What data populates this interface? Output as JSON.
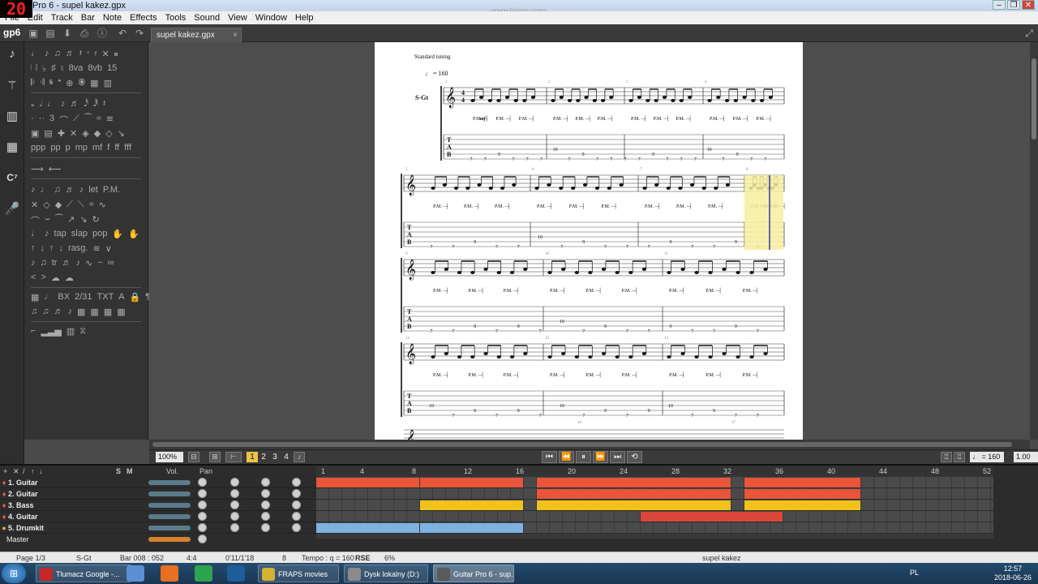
{
  "window": {
    "fps_counter": "20",
    "title": "Pro 6 - supel kakez.gpx",
    "watermark": "www.fraps.com",
    "controls": [
      "–",
      "❐",
      "✕"
    ]
  },
  "menu": [
    "File",
    "Edit",
    "Track",
    "Bar",
    "Note",
    "Effects",
    "Tools",
    "Sound",
    "View",
    "Window",
    "Help"
  ],
  "toolbar": {
    "logo": "gp6",
    "document_tab": "supel kakez.gpx",
    "tab_close": "×"
  },
  "score": {
    "tuning": "Standard tuning",
    "tempo_mark": "♩ = 160",
    "track_label": "S-Gt",
    "dynamic": "mf",
    "palm_mute": "P.M.",
    "tab_letters": [
      "T",
      "A",
      "B"
    ],
    "measure_numbers": [
      "1",
      "2",
      "3",
      "4",
      "5",
      "6",
      "7",
      "8",
      "9",
      "10",
      "11",
      "12",
      "13",
      "14",
      "15",
      "16",
      "17"
    ],
    "tab_numbers_row1": [
      "7",
      "7",
      "9",
      "7",
      "7",
      "7",
      "10",
      "7",
      "9",
      "7",
      "7",
      "7",
      "7",
      "9",
      "7",
      "7",
      "7",
      "10",
      "7",
      "9",
      "7",
      "7"
    ],
    "tab_numbers_row2": [
      "7",
      "7",
      "9",
      "7",
      "7",
      "10",
      "7",
      "9",
      "7",
      "7",
      "7",
      "9",
      "7",
      "7",
      "9",
      "7"
    ],
    "tab_numbers_row3": [
      "7",
      "7",
      "9",
      "7",
      "9",
      "7",
      "10",
      "7",
      "9",
      "7",
      "7",
      "9",
      "7",
      "7",
      "9",
      "7"
    ],
    "tab_numbers_row4": [
      "10",
      "7",
      "9",
      "7",
      "9",
      "7",
      "10",
      "7",
      "9",
      "7",
      "9",
      "10",
      "7",
      "9",
      "7",
      "7"
    ]
  },
  "bottom_toolbar": {
    "zoom": "100%",
    "page_numbers": [
      "1",
      "2",
      "3",
      "4"
    ],
    "tempo": "♩ = 160",
    "speed": "1.00"
  },
  "tracks_header": {
    "solo": "S",
    "mute": "M",
    "vol": "Vol.",
    "pan": "Pan"
  },
  "timeline_ruler": [
    "1",
    "4",
    "8",
    "12",
    "16",
    "20",
    "24",
    "28",
    "32",
    "36",
    "40",
    "44",
    "48",
    "52"
  ],
  "tracks": [
    {
      "name": "1. Guitar",
      "color": "#e8553a",
      "icon": "guitar-icon"
    },
    {
      "name": "2. Guitar",
      "color": "#e8553a",
      "icon": "guitar-icon"
    },
    {
      "name": "3. Bass",
      "color": "#f2c21b",
      "icon": "bass-icon"
    },
    {
      "name": "4. Guitar",
      "color": "#d9473a",
      "icon": "guitar-icon"
    },
    {
      "name": "5. Drumkit",
      "color": "#7fb2e0",
      "icon": "drum-icon"
    }
  ],
  "master_label": "Master",
  "clips": [
    [
      {
        "start": 1,
        "end": 8
      },
      {
        "start": 9,
        "end": 16
      },
      {
        "start": 18,
        "end": 32
      },
      {
        "start": 34,
        "end": 42
      }
    ],
    [
      {
        "start": 18,
        "end": 32
      },
      {
        "start": 34,
        "end": 42
      }
    ],
    [
      {
        "start": 9,
        "end": 16
      },
      {
        "start": 18,
        "end": 32
      },
      {
        "start": 34,
        "end": 42
      }
    ],
    [
      {
        "start": 26,
        "end": 36
      }
    ],
    [
      {
        "start": 1,
        "end": 8
      },
      {
        "start": 9,
        "end": 16
      }
    ]
  ],
  "status": {
    "page": "Page 1/3",
    "track": "S-Gt",
    "bar": "Bar 008 : 052",
    "signature": "4:4",
    "time": "0'11/1'18",
    "notes": "8",
    "tempo": "Tempo : q = 160",
    "rse": "RSE",
    "volume": "6%",
    "file": "supel kakez"
  },
  "taskbar": {
    "items": [
      {
        "label": "Tlumacz Google -...",
        "color": "#c62828"
      },
      {
        "label": "FRAPS movies",
        "color": "#d4b233"
      },
      {
        "label": "Dysk lokalny (D:)",
        "color": "#8b8b8b"
      },
      {
        "label": "Guitar Pro 6 - sup...",
        "color": "#5a5a5a"
      }
    ],
    "lang": "PL",
    "time": "12:57",
    "date": "2018-06-26"
  }
}
